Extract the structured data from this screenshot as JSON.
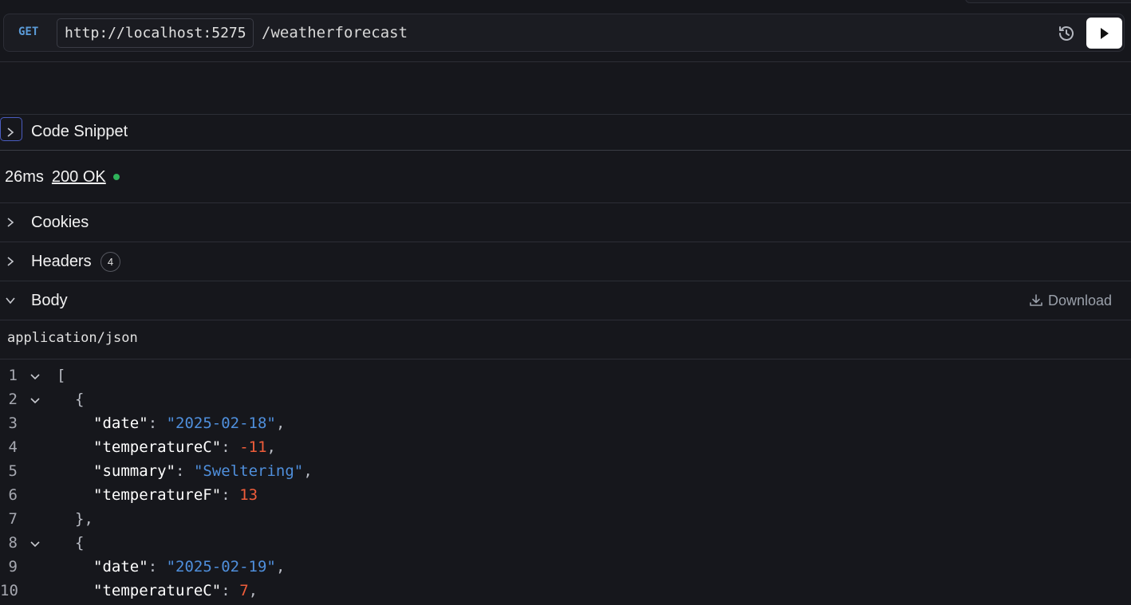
{
  "request": {
    "method": "GET",
    "base_url": "http://localhost:5275",
    "path": "/weatherforecast"
  },
  "sections": {
    "code_snippet": "Code Snippet",
    "cookies": "Cookies",
    "headers": "Headers",
    "headers_count": "4",
    "body": "Body",
    "download": "Download"
  },
  "status": {
    "latency": "26ms",
    "code": "200 OK",
    "ok_color": "#2fb35a"
  },
  "body": {
    "content_type": "application/json",
    "lines": [
      {
        "n": "1",
        "fold": true,
        "indent": 0,
        "tokens": [
          {
            "t": "[",
            "c": "punct"
          }
        ]
      },
      {
        "n": "2",
        "fold": true,
        "indent": 1,
        "tokens": [
          {
            "t": "{",
            "c": "punct"
          }
        ]
      },
      {
        "n": "3",
        "fold": false,
        "indent": 2,
        "tokens": [
          {
            "t": "\"date\"",
            "c": "key"
          },
          {
            "t": ": ",
            "c": "punct"
          },
          {
            "t": "\"2025-02-18\"",
            "c": "str"
          },
          {
            "t": ",",
            "c": "punct"
          }
        ]
      },
      {
        "n": "4",
        "fold": false,
        "indent": 2,
        "tokens": [
          {
            "t": "\"temperatureC\"",
            "c": "key"
          },
          {
            "t": ": ",
            "c": "punct"
          },
          {
            "t": "-11",
            "c": "num"
          },
          {
            "t": ",",
            "c": "punct"
          }
        ]
      },
      {
        "n": "5",
        "fold": false,
        "indent": 2,
        "tokens": [
          {
            "t": "\"summary\"",
            "c": "key"
          },
          {
            "t": ": ",
            "c": "punct"
          },
          {
            "t": "\"Sweltering\"",
            "c": "str"
          },
          {
            "t": ",",
            "c": "punct"
          }
        ]
      },
      {
        "n": "6",
        "fold": false,
        "indent": 2,
        "tokens": [
          {
            "t": "\"temperatureF\"",
            "c": "key"
          },
          {
            "t": ": ",
            "c": "punct"
          },
          {
            "t": "13",
            "c": "num"
          }
        ]
      },
      {
        "n": "7",
        "fold": false,
        "indent": 1,
        "tokens": [
          {
            "t": "},",
            "c": "punct"
          }
        ]
      },
      {
        "n": "8",
        "fold": true,
        "indent": 1,
        "tokens": [
          {
            "t": "{",
            "c": "punct"
          }
        ]
      },
      {
        "n": "9",
        "fold": false,
        "indent": 2,
        "tokens": [
          {
            "t": "\"date\"",
            "c": "key"
          },
          {
            "t": ": ",
            "c": "punct"
          },
          {
            "t": "\"2025-02-19\"",
            "c": "str"
          },
          {
            "t": ",",
            "c": "punct"
          }
        ]
      },
      {
        "n": "10",
        "fold": false,
        "indent": 2,
        "tokens": [
          {
            "t": "\"temperatureC\"",
            "c": "key"
          },
          {
            "t": ": ",
            "c": "punct"
          },
          {
            "t": "7",
            "c": "num"
          },
          {
            "t": ",",
            "c": "punct"
          }
        ]
      }
    ]
  }
}
